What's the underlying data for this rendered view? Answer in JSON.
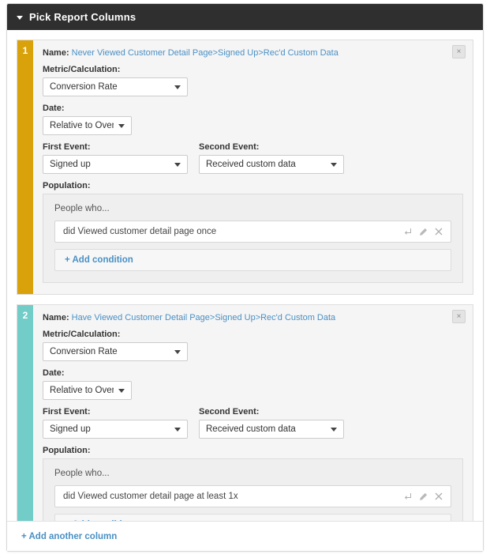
{
  "header": {
    "title": "Pick Report Columns",
    "collapse_icon": "caret-down-icon"
  },
  "labels": {
    "name": "Name:",
    "metric": "Metric/Calculation:",
    "date": "Date:",
    "first_event": "First Event:",
    "second_event": "Second Event:",
    "population": "Population:",
    "people_who": "People who...",
    "add_condition": "+ Add condition",
    "close": "×"
  },
  "columns": [
    {
      "index": "1",
      "accent_color": "#d9a20a",
      "name": "Never Viewed Customer Detail Page>Signed Up>Rec'd Custom Data",
      "metric": "Conversion Rate",
      "date": "Relative to Over Ti",
      "first_event": "Signed up",
      "second_event": "Received custom data",
      "conditions": [
        {
          "text": "did Viewed customer detail page once",
          "icons": [
            "branch-icon",
            "pencil-icon",
            "close-icon"
          ]
        }
      ]
    },
    {
      "index": "2",
      "accent_color": "#72ccc8",
      "name": "Have Viewed Customer Detail Page>Signed Up>Rec'd Custom Data",
      "metric": "Conversion Rate",
      "date": "Relative to Over Ti",
      "first_event": "Signed up",
      "second_event": "Received custom data",
      "conditions": [
        {
          "text": "did Viewed customer detail page at least 1x",
          "icons": [
            "branch-icon",
            "pencil-icon",
            "close-icon"
          ]
        }
      ]
    }
  ],
  "footer": {
    "add_column": "+ Add another column"
  }
}
